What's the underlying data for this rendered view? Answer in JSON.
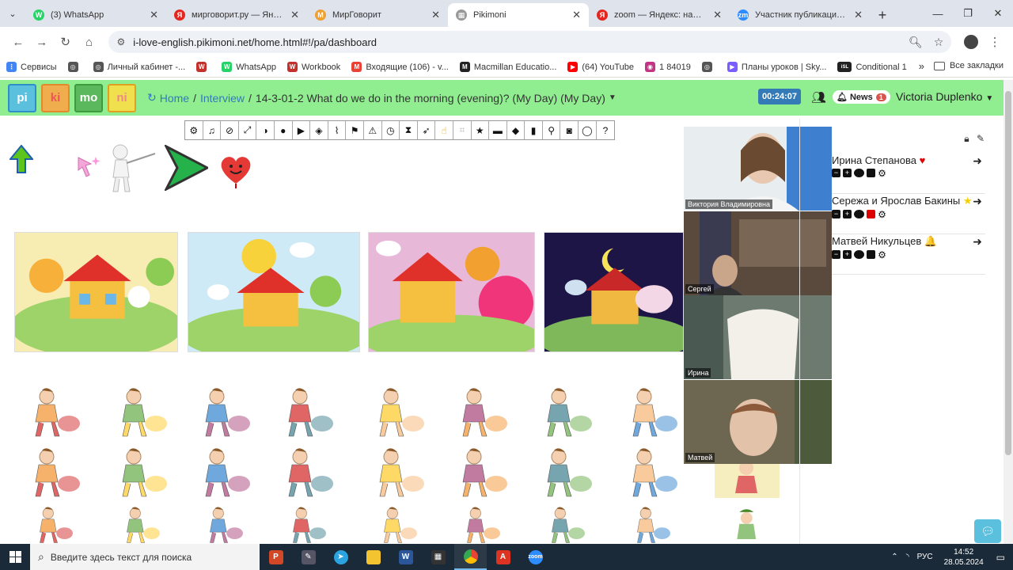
{
  "browser": {
    "tabs": [
      {
        "title": "(3) WhatsApp",
        "icon": "whatsapp-icon",
        "color": "#25d366",
        "glyph": "W"
      },
      {
        "title": "мирговорит.ру — Яндекс",
        "icon": "yandex-icon",
        "color": "#e52620",
        "glyph": "Я"
      },
      {
        "title": "МирГоворит",
        "icon": "mirgovorit-icon",
        "color": "#f0a030",
        "glyph": "M"
      },
      {
        "title": "Pikimoni",
        "icon": "pikimoni-icon",
        "color": "#999999",
        "glyph": "▦"
      },
      {
        "title": "zoom — Яндекс: нашлось",
        "icon": "yandex-icon",
        "color": "#e52620",
        "glyph": "Я"
      },
      {
        "title": "Участник публикации - Z",
        "icon": "zoom-icon",
        "color": "#2d8cff",
        "glyph": "zm"
      }
    ],
    "active_tab": 3,
    "url": "i-love-english.pikimoni.net/home.html#!/pa/dashboard",
    "bookmarks": [
      {
        "label": "Сервисы",
        "color": "#4285f4",
        "glyph": "⋮"
      },
      {
        "label": "",
        "color": "#555555",
        "glyph": "◎"
      },
      {
        "label": "Личный кабинет -...",
        "color": "#555555",
        "glyph": "◎"
      },
      {
        "label": "",
        "color": "#c4302b",
        "glyph": "W"
      },
      {
        "label": "WhatsApp",
        "color": "#25d366",
        "glyph": "W"
      },
      {
        "label": "Workbook",
        "color": "#c4302b",
        "glyph": "W"
      },
      {
        "label": "Входящие (106) - v...",
        "color": "#ea4335",
        "glyph": "M"
      },
      {
        "label": "Macmillan Educatio...",
        "color": "#222222",
        "glyph": "M"
      },
      {
        "label": "(64) YouTube",
        "color": "#ff0000",
        "glyph": "▶"
      },
      {
        "label": "1 84019",
        "color": "#c13584",
        "glyph": "◉"
      },
      {
        "label": "",
        "color": "#555555",
        "glyph": "◎"
      },
      {
        "label": "Планы уроков | Sky...",
        "color": "#7b5cff",
        "glyph": "▶"
      },
      {
        "label": "Conditional 1",
        "color": "#222222",
        "glyph": "iSL"
      }
    ],
    "bookmarks_all": "Все закладки"
  },
  "header": {
    "logo": [
      "pi",
      "ki",
      "mo",
      "ni"
    ],
    "breadcrumb_home": "Home",
    "breadcrumb_section": "Interview",
    "breadcrumb_current": "14-3-01-2 What do we do in the morning (evening)? (My Day) (My Day)",
    "timer": "00:24:07",
    "news_label": "News",
    "news_count": "1",
    "user_name": "Victoria Duplenko"
  },
  "toolbar": [
    "gear-icon",
    "music-icon",
    "ban-icon",
    "expand-icon",
    "contrast-icon",
    "circle-icon",
    "play-icon",
    "eye-slash-icon",
    "rss-icon",
    "flag-icon",
    "warning-icon",
    "clock-icon",
    "hourglass-icon",
    "rocket-icon",
    "pointer-icon",
    "crop-icon",
    "star-icon",
    "keyboard-icon",
    "cube-icon",
    "bookmark-icon",
    "pin-icon",
    "camera-icon",
    "comment-icon",
    "question-icon"
  ],
  "videos": [
    {
      "label": "Виктория Владимировна"
    },
    {
      "label": "Сергей"
    },
    {
      "label": "Ирина"
    },
    {
      "label": "Матвей"
    }
  ],
  "participants": [
    {
      "name": "Ирина Степанова",
      "badge": "♥",
      "badge_color": "#e00000",
      "lock_red": false
    },
    {
      "name": "Сережа и Ярослав Бакины",
      "badge": "★",
      "badge_color": "#f5d000",
      "lock_red": true
    },
    {
      "name": "Матвей Никульцев",
      "badge": "🔔",
      "badge_color": "#9b30c8",
      "lock_red": false
    }
  ],
  "taskbar": {
    "search_placeholder": "Введите здесь текст для поиска",
    "lang": "РУС",
    "time": "14:52",
    "date": "28.05.2024"
  },
  "colors": {
    "header_bg": "#90ee90",
    "link": "#337ab7",
    "timer_bg": "#337ab7",
    "news_badge": "#d9534f"
  }
}
